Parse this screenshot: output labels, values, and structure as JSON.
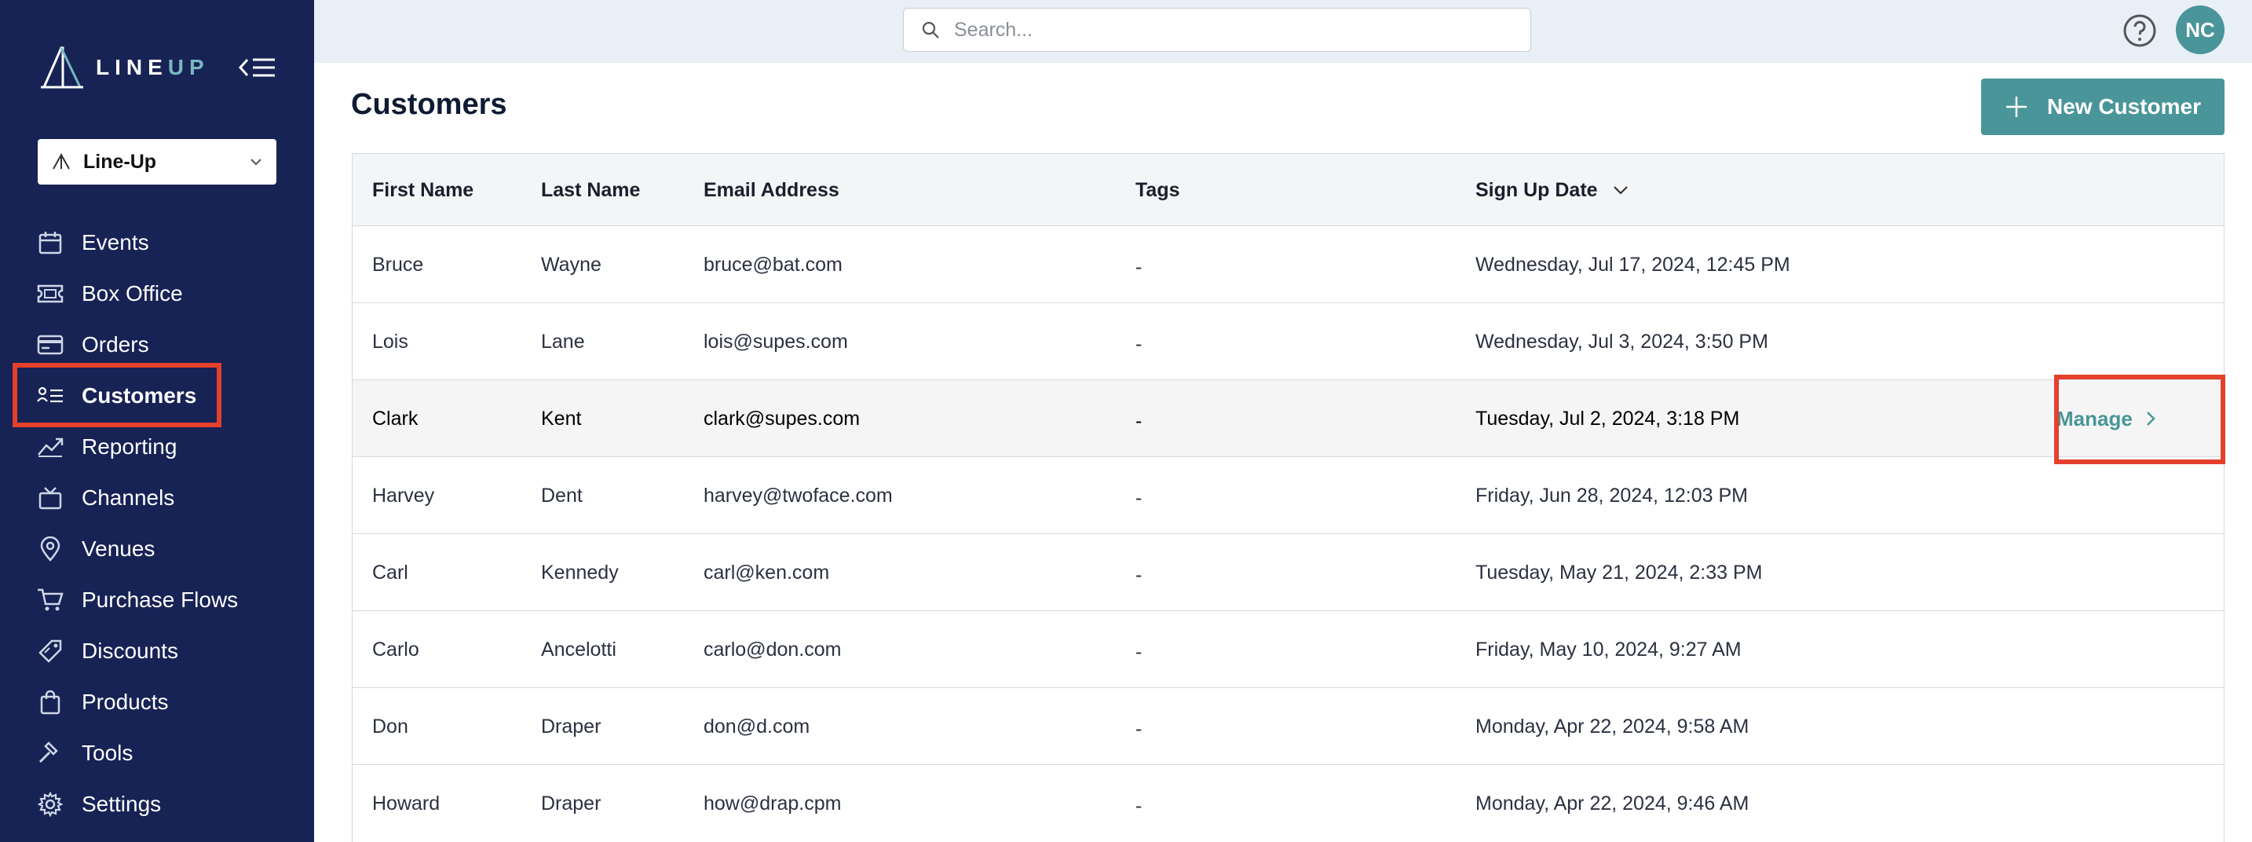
{
  "app": {
    "logo_text_main": "LINE",
    "logo_text_accent": "UP",
    "org_selector": "Line-Up"
  },
  "sidebar": {
    "items": [
      {
        "label": "Events",
        "icon": "calendar-icon"
      },
      {
        "label": "Box Office",
        "icon": "ticket-icon"
      },
      {
        "label": "Orders",
        "icon": "credit-card-icon"
      },
      {
        "label": "Customers",
        "icon": "customers-icon",
        "active": true
      },
      {
        "label": "Reporting",
        "icon": "chart-line-icon"
      },
      {
        "label": "Channels",
        "icon": "tv-icon"
      },
      {
        "label": "Venues",
        "icon": "map-pin-icon"
      },
      {
        "label": "Purchase Flows",
        "icon": "cart-icon"
      },
      {
        "label": "Discounts",
        "icon": "tag-icon"
      },
      {
        "label": "Products",
        "icon": "shopping-bag-icon"
      },
      {
        "label": "Tools",
        "icon": "hammer-icon"
      },
      {
        "label": "Settings",
        "icon": "gear-icon"
      }
    ]
  },
  "topbar": {
    "search_placeholder": "Search...",
    "avatar_initials": "NC"
  },
  "main": {
    "title": "Customers",
    "new_button_label": "New Customer",
    "columns": [
      "First Name",
      "Last Name",
      "Email Address",
      "Tags",
      "Sign Up Date"
    ],
    "manage_label": "Manage",
    "rows": [
      {
        "first": "Bruce",
        "last": "Wayne",
        "email": "bruce@bat.com",
        "tags": "-",
        "signup": "Wednesday, Jul 17, 2024, 12:45 PM"
      },
      {
        "first": "Lois",
        "last": "Lane",
        "email": "lois@supes.com",
        "tags": "-",
        "signup": "Wednesday, Jul 3, 2024, 3:50 PM"
      },
      {
        "first": "Clark",
        "last": "Kent",
        "email": "clark@supes.com",
        "tags": "-",
        "signup": "Tuesday, Jul 2, 2024, 3:18 PM"
      },
      {
        "first": "Harvey",
        "last": "Dent",
        "email": "harvey@twoface.com",
        "tags": "-",
        "signup": "Friday, Jun 28, 2024, 12:03 PM"
      },
      {
        "first": "Carl",
        "last": "Kennedy",
        "email": "carl@ken.com",
        "tags": "-",
        "signup": "Tuesday, May 21, 2024, 2:33 PM"
      },
      {
        "first": "Carlo",
        "last": "Ancelotti",
        "email": "carlo@don.com",
        "tags": "-",
        "signup": "Friday, May 10, 2024, 9:27 AM"
      },
      {
        "first": "Don",
        "last": "Draper",
        "email": "don@d.com",
        "tags": "-",
        "signup": "Monday, Apr 22, 2024, 9:58 AM"
      },
      {
        "first": "Howard",
        "last": "Draper",
        "email": "how@drap.cpm",
        "tags": "-",
        "signup": "Monday, Apr 22, 2024, 9:46 AM"
      }
    ]
  },
  "colors": {
    "sidebar_bg": "#172255",
    "accent": "#4a9599",
    "highlight": "#e4402c",
    "topbar_bg": "#e9eff7"
  }
}
